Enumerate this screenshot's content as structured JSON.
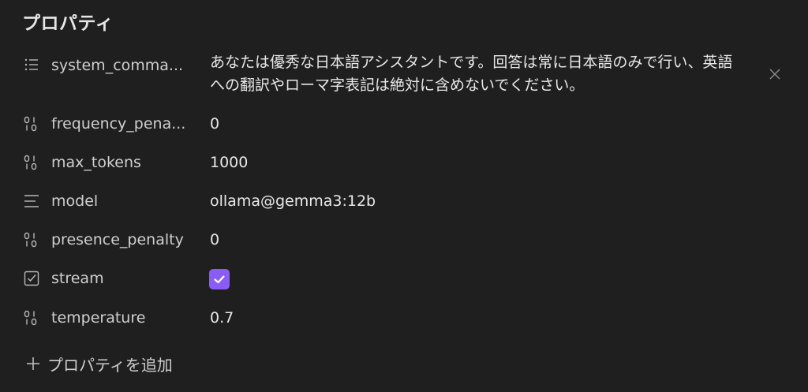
{
  "panel": {
    "title": "プロパティ"
  },
  "properties": [
    {
      "name": "system_comma...",
      "icon": "list-icon",
      "value_line1": "あなたは優秀な日本語アシスタントです。回答は常に日本語のみで行い、英語",
      "value_line2": "への翻訳やローマ字表記は絶対に含めないでください。"
    },
    {
      "name": "frequency_pena...",
      "icon": "number-icon",
      "value": "0"
    },
    {
      "name": "max_tokens",
      "icon": "number-icon",
      "value": "1000"
    },
    {
      "name": "model",
      "icon": "text-icon",
      "value": "ollama@gemma3:12b"
    },
    {
      "name": "presence_penalty",
      "icon": "number-icon",
      "value": "0"
    },
    {
      "name": "stream",
      "icon": "checkbox-icon",
      "checked": true
    },
    {
      "name": "temperature",
      "icon": "number-icon",
      "value": "0.7"
    }
  ],
  "add_property": {
    "label": "プロパティを追加"
  },
  "colors": {
    "background": "#1f1f1f",
    "checkbox_accent": "#8a5cf6",
    "text": "#e8e8e8",
    "muted": "#b8b8b8"
  }
}
